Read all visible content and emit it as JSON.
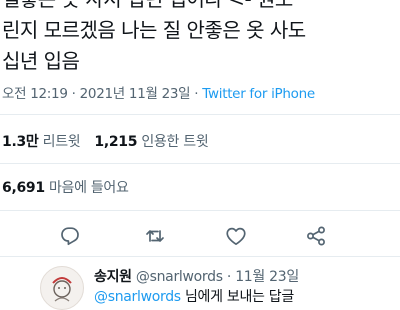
{
  "tweet": {
    "lines": [
      "실좋은 옷 사서 십년 입어라 <- 원소",
      "린지 모르겠음 나는 질 안좋은 옷 사도",
      "십년 입음"
    ],
    "time": "오전 12:19",
    "separator": "·",
    "date": "2021년 11월 23일",
    "source": "Twitter for iPhone"
  },
  "stats": {
    "retweets_count": "1.3만",
    "retweets_label": "리트윗",
    "quotes_count": "1,215",
    "quotes_label": "인용한 트윗",
    "likes_count": "6,691",
    "likes_label": "마음에 들어요"
  },
  "actions": {
    "icons": [
      "reply-icon",
      "retweet-icon",
      "like-icon",
      "share-icon"
    ]
  },
  "reply": {
    "name": "송지원",
    "handle": "@snarlwords",
    "separator": "·",
    "date": "11월 23일",
    "mention": "@snarlwords",
    "text": "님에게 보내는 답글"
  },
  "colors": {
    "accent": "#1d9bf0",
    "muted": "#536471",
    "text": "#0f1419",
    "divider": "#e6ecf0"
  }
}
